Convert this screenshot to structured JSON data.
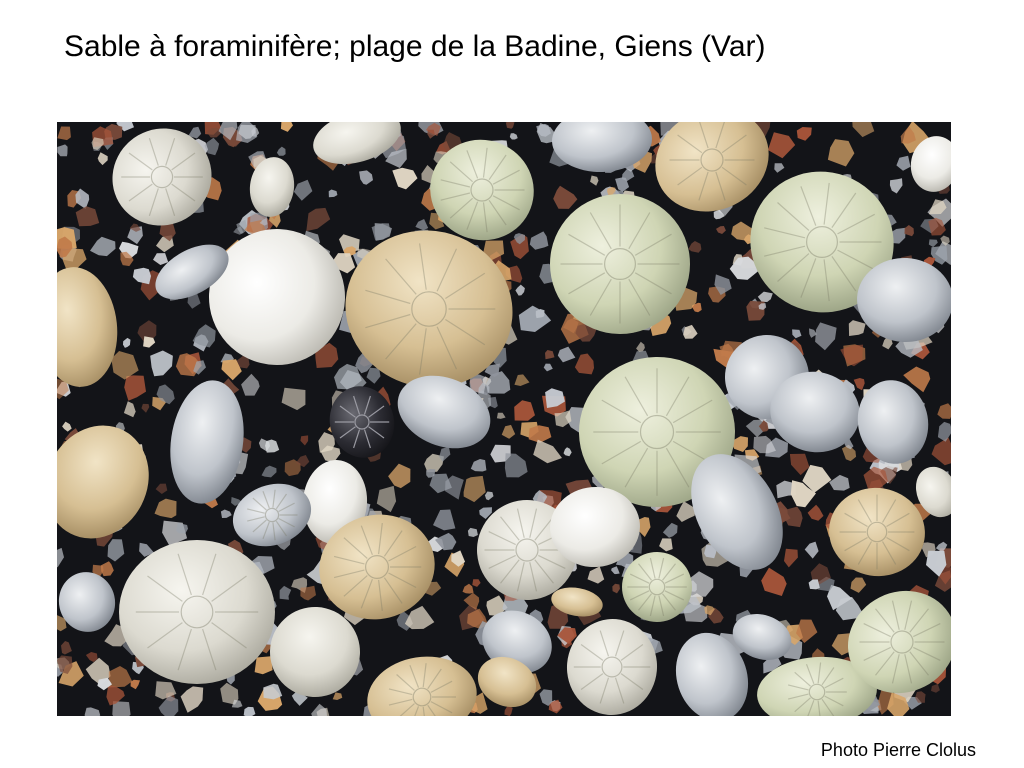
{
  "slide": {
    "title": "Sable à foraminifère; plage de la Badine, Giens (Var)",
    "credit": "Photo Pierre Clolus"
  },
  "photo": {
    "subject": "foraminifera-sand-grains-macro-photo",
    "colors": {
      "background": "#131418",
      "shell_light": "#e8e6dc",
      "shell_green": "#d3d8b8",
      "shell_tan": "#d9c49a",
      "quartz": "#c9ccd2",
      "red_grain": "#a8553a",
      "dark_shell": "#2a2a30"
    }
  }
}
